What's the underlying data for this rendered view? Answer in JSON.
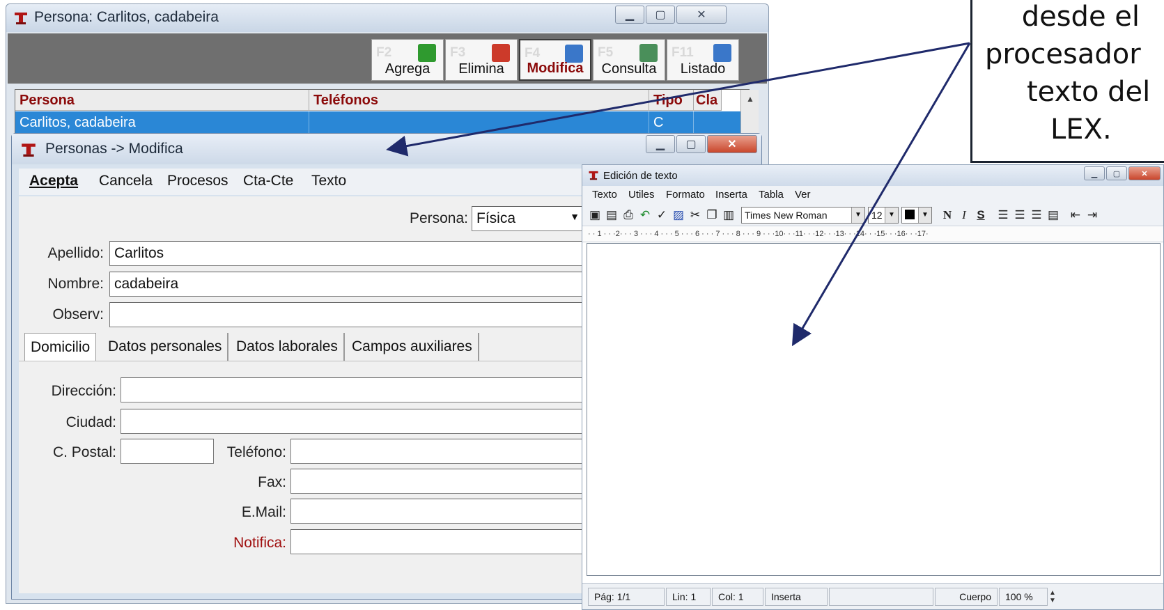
{
  "win1": {
    "title": "Persona: Carlitos, cadabeira",
    "toolbar": [
      {
        "fkey": "F2",
        "label": "Agrega",
        "icon": "add-icon",
        "color": "#2f9a2f"
      },
      {
        "fkey": "F3",
        "label": "Elimina",
        "icon": "delete-icon",
        "color": "#cc3a2a"
      },
      {
        "fkey": "F4",
        "label": "Modifica",
        "icon": "modify-icon",
        "color": "#3a77c9"
      },
      {
        "fkey": "F5",
        "label": "Consulta",
        "icon": "query-icon",
        "color": "#4a8f5a"
      },
      {
        "fkey": "F11",
        "label": "Listado",
        "icon": "list-icon",
        "color": "#3a77c9"
      }
    ],
    "grid": {
      "headers": [
        "Persona",
        "Teléfonos",
        "Tipo",
        "Cla"
      ],
      "row": {
        "persona": "Carlitos, cadabeira",
        "telefonos": "",
        "tipo": "C",
        "cla": ""
      }
    }
  },
  "win2": {
    "title": "Personas -> Modifica",
    "menu": [
      "Acepta",
      "Cancela",
      "Procesos",
      "Cta-Cte",
      "Texto"
    ],
    "persona_label": "Persona:",
    "persona_value": "Física",
    "fields": {
      "apellido_label": "Apellido:",
      "apellido": "Carlitos",
      "nombre_label": "Nombre:",
      "nombre": "cadabeira",
      "observ_label": "Observ:",
      "observ": ""
    },
    "tabs": [
      "Domicilio",
      "Datos personales",
      "Datos laborales",
      "Campos auxiliares"
    ],
    "address": {
      "direccion_label": "Dirección:",
      "ciudad_label": "Ciudad:",
      "cpostal_label": "C. Postal:",
      "telefono_label": "Teléfono:",
      "fax_label": "Fax:",
      "email_label": "E.Mail:",
      "notifica_label": "Notifica:"
    }
  },
  "win3": {
    "title": "Edición de texto",
    "menu": [
      "Texto",
      "Utiles",
      "Formato",
      "Inserta",
      "Tabla",
      "Ver"
    ],
    "font": "Times New Roman",
    "size": "12",
    "format_buttons": [
      "N",
      "I",
      "S"
    ],
    "ruler": "· · 1 · · ·2· · · 3 · · · 4 · · · 5 · · · 6 · · · 7 · · · 8 · · · 9 · · ·10· · ·11· · ·12· · ·13· · ·14· · ·15· · ·16· · ·17·",
    "status": {
      "page": "Pág: 1/1",
      "line": "Lin: 1",
      "col": "Col: 1",
      "mode": "Inserta",
      "style": "Cuerpo",
      "zoom": "100 %"
    }
  },
  "callout": {
    "lines": [
      "desde el",
      "procesador",
      "texto del",
      "LEX."
    ]
  }
}
